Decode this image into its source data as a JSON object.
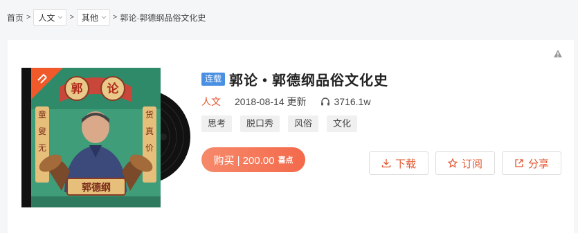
{
  "breadcrumb": {
    "home": "首页",
    "separator": ">",
    "level1": "人文",
    "level2": "其他",
    "current": "郭论·郭德纲品俗文化史"
  },
  "album": {
    "cover_alt": "郭论 郭德纲",
    "serial_badge": "连载",
    "title": "郭论 • 郭德纲品俗文化史",
    "category": "人文",
    "date": "2018-08-14 更新",
    "play_count": "3716.1w",
    "tags": [
      "思考",
      "脱口秀",
      "风俗",
      "文化"
    ]
  },
  "actions": {
    "buy_label": "购买 | 200.00",
    "buy_unit": "喜点",
    "download": "下载",
    "subscribe": "订阅",
    "share": "分享"
  },
  "colors": {
    "accent": "#e2562e",
    "badge_blue": "#4a90e2",
    "buy_gradient_start": "#f6896b",
    "buy_gradient_end": "#f46a4b"
  }
}
